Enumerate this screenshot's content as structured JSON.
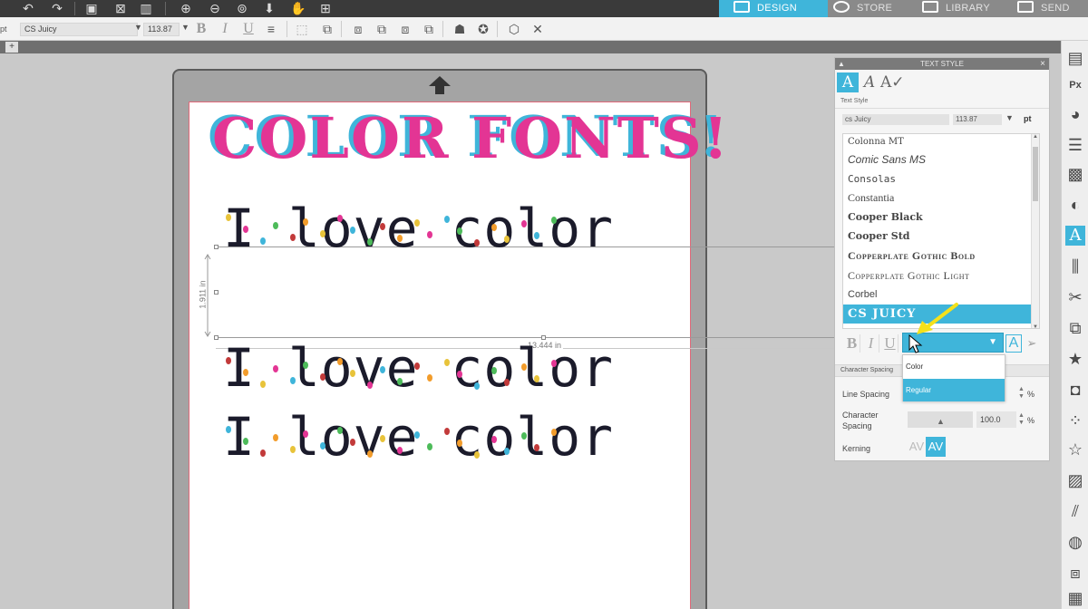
{
  "nav": {
    "tabs": [
      {
        "label": "DESIGN",
        "active": true
      },
      {
        "label": "STORE",
        "active": false
      },
      {
        "label": "LIBRARY",
        "active": false
      },
      {
        "label": "SEND",
        "active": false
      }
    ]
  },
  "format_bar": {
    "unit_prefix": "pt",
    "font_value": "CS Juicy",
    "size_value": "113.87",
    "bold": "B",
    "italic": "I",
    "underline": "U"
  },
  "doc_tabs": {
    "add_label": "+"
  },
  "canvas": {
    "title": "COLOR FONTS!",
    "lines": [
      "I love color",
      "I love color",
      "I love color"
    ],
    "height_dim": "1.911 in",
    "width_dim": "13.444 in",
    "colors": {
      "title_main": "#e33594",
      "title_shadow": "#3fb5da"
    }
  },
  "panel": {
    "title": "TEXT STYLE",
    "close": "×",
    "sub_label": "Text Style",
    "font_input": "cs Juicy",
    "size_input": "113.87",
    "size_unit": "pt",
    "fonts": [
      {
        "label": "Colonna MT"
      },
      {
        "label": "Comic Sans MS"
      },
      {
        "label": "Consolas"
      },
      {
        "label": "Constantia"
      },
      {
        "label": "Cooper Black"
      },
      {
        "label": "Cooper Std"
      },
      {
        "label": "Copperplate Gothic Bold"
      },
      {
        "label": "Copperplate Gothic Light"
      },
      {
        "label": "Corbel"
      },
      {
        "label": "CS JUICY",
        "selected": true
      }
    ],
    "style_buttons": {
      "bold": "B",
      "italic": "I",
      "underline": "U"
    },
    "dropdown_options": [
      {
        "label": "Color"
      },
      {
        "label": "Regular",
        "highlighted": true
      }
    ],
    "section_label": "Character Spacing",
    "line_spacing_label": "Line Spacing",
    "line_spacing_pct": "%",
    "char_spacing_label": "Character Spacing",
    "char_spacing_value": "100.0",
    "char_spacing_pct": "%",
    "kerning_label": "Kerning",
    "kerning_off": "AV",
    "kerning_on": "AV"
  },
  "accent_color": "#3fb5da",
  "annotation_color": "#f5e11a"
}
